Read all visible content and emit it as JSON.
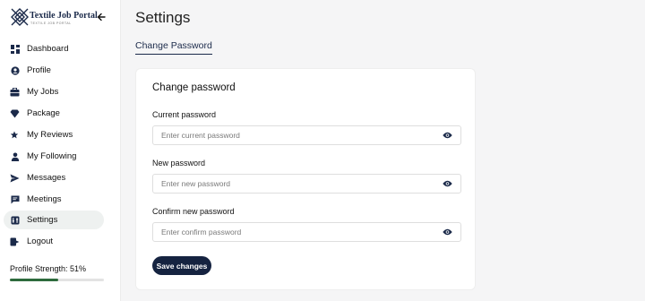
{
  "brand": {
    "name": "Textile Job Portal",
    "tagline": "TEXTILE JOB PORTAL",
    "logo_icon": "diamond-knot-logo",
    "collapse_icon": "arrow-left-icon"
  },
  "sidebar": {
    "items": [
      {
        "label": "Dashboard",
        "icon": "dashboard-icon",
        "active": false
      },
      {
        "label": "Profile",
        "icon": "user-circle-icon",
        "active": false
      },
      {
        "label": "My Jobs",
        "icon": "jobs-icon",
        "active": false
      },
      {
        "label": "Package",
        "icon": "diamond-icon",
        "active": false
      },
      {
        "label": "My Reviews",
        "icon": "reviews-icon",
        "active": false
      },
      {
        "label": "My Following",
        "icon": "person-icon",
        "active": false
      },
      {
        "label": "Messages",
        "icon": "send-icon",
        "active": false
      },
      {
        "label": "Meetings",
        "icon": "chat-icon",
        "active": false
      },
      {
        "label": "Settings",
        "icon": "settings-icon",
        "active": true
      },
      {
        "label": "Logout",
        "icon": "logout-icon",
        "active": false
      }
    ],
    "profile_strength_label": "Profile Strength: 51%",
    "profile_strength_value": 0.51
  },
  "header": {
    "title": "Settings",
    "tab": "Change Password"
  },
  "form": {
    "title": "Change password",
    "fields": [
      {
        "label": "Current password",
        "placeholder": "Enter current password",
        "value": "",
        "icon": "eye-icon"
      },
      {
        "label": "New password",
        "placeholder": "Enter new password",
        "value": "",
        "icon": "eye-icon"
      },
      {
        "label": "Confirm new password",
        "placeholder": "Enter confirm password",
        "value": "",
        "icon": "eye-icon"
      }
    ],
    "submit_label": "Save changes"
  },
  "colors": {
    "accent": "#152340",
    "progress": "#2e6b3d",
    "active_bg": "#eef1f0",
    "page_bg": "#f5f5f6"
  }
}
